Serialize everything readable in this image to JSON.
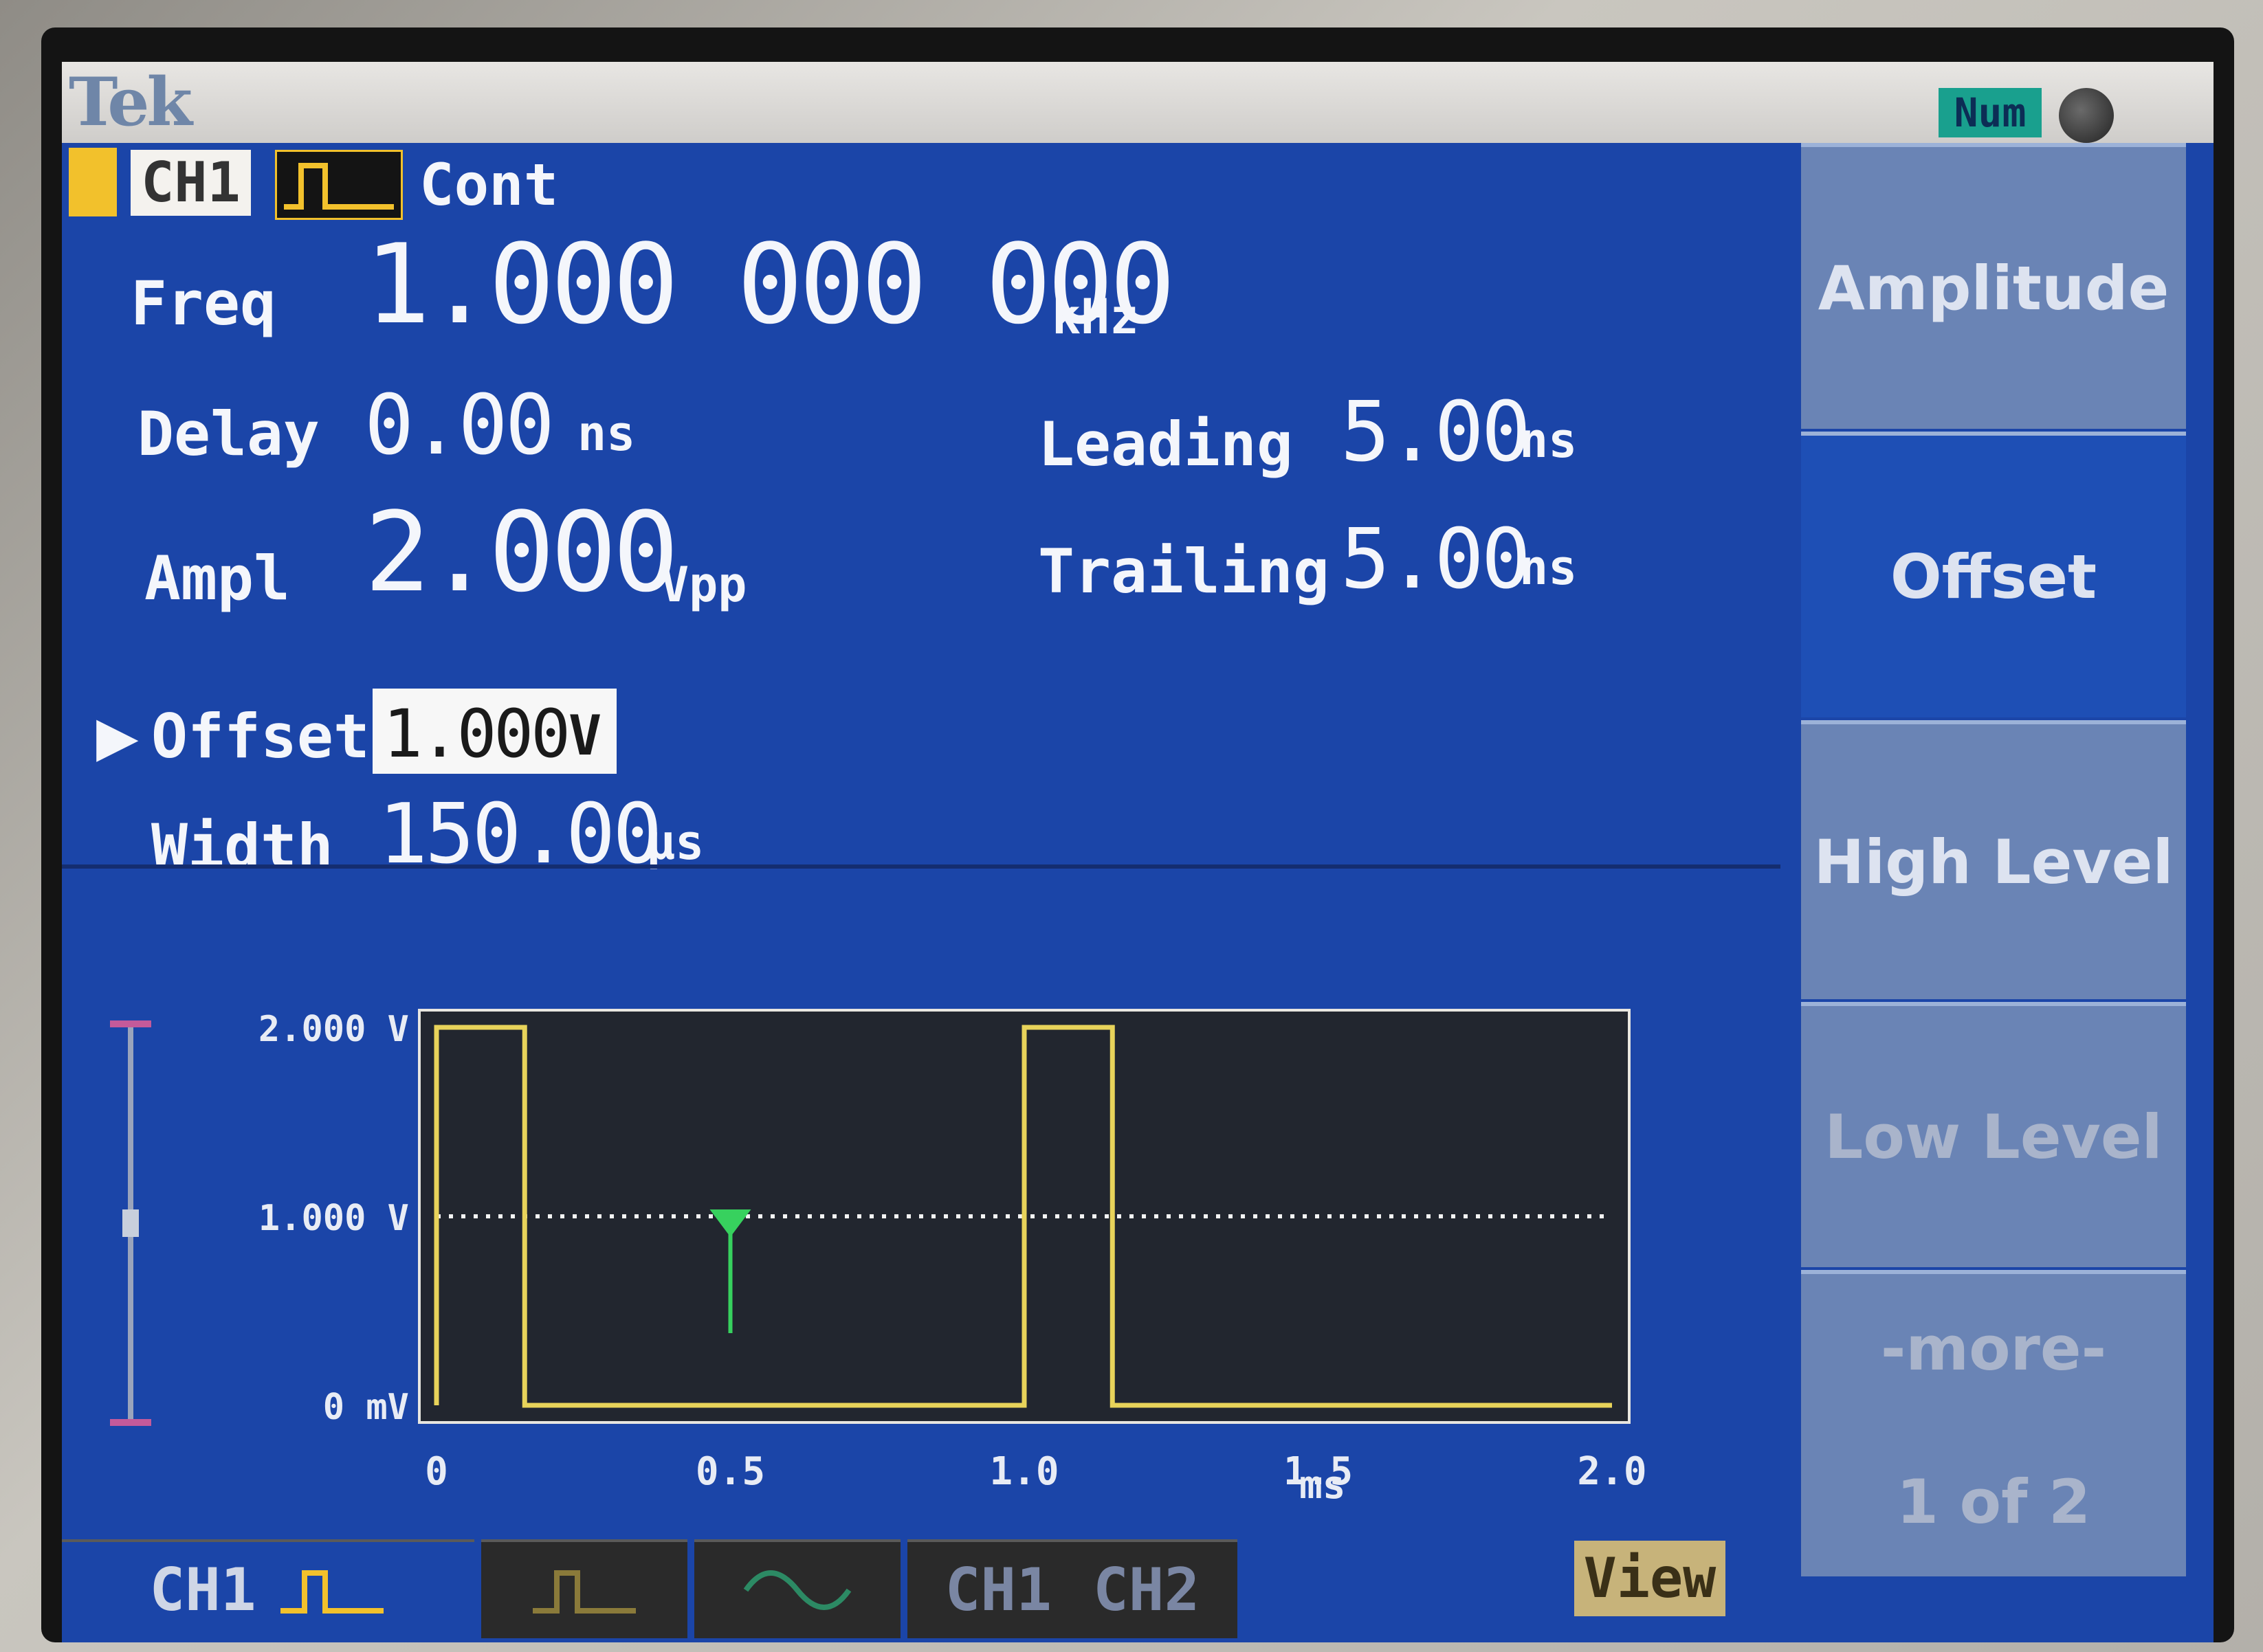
{
  "header": {
    "brand": "Tek",
    "num_badge": "Num"
  },
  "channel": {
    "label": "CH1",
    "mode": "Cont",
    "indicator_color": "#f2c12c"
  },
  "params": {
    "freq": {
      "label": "Freq",
      "value": "1.000 000 000",
      "unit": "kHz"
    },
    "delay": {
      "label": "Delay",
      "value": "0.00",
      "unit": "ns"
    },
    "ampl": {
      "label": "Ampl",
      "value": "2.000",
      "unit": "Vpp"
    },
    "offset": {
      "label": "Offset",
      "value": "1.000",
      "unit": "V"
    },
    "width": {
      "label": "Width",
      "value": "150.00",
      "unit": "µs"
    },
    "leading": {
      "label": "Leading",
      "value": "5.00",
      "unit": "ns"
    },
    "trailing": {
      "label": "Trailing",
      "value": "5.00",
      "unit": "ns"
    }
  },
  "softkeys": [
    {
      "label": "Amplitude",
      "active": false
    },
    {
      "label": "Offset",
      "active": true
    },
    {
      "label": "High Level",
      "active": false
    },
    {
      "label": "Low Level",
      "active": false
    },
    {
      "label": "-more-",
      "active": false
    },
    {
      "label": "1 of 2",
      "active": false
    }
  ],
  "tabs": [
    {
      "label": "CH1",
      "icon": "pulse-icon"
    },
    {
      "label": "",
      "icon": "pulse-icon"
    },
    {
      "label": "",
      "icon": "sine-icon"
    },
    {
      "label": "CH1",
      "icon": ""
    },
    {
      "label": "CH2",
      "icon": ""
    }
  ],
  "view_label": "View",
  "colors": {
    "screen_bg": "#1b45a8",
    "trace": "#e8d35a",
    "marker": "#37d15e",
    "plot_bg": "#22262f"
  },
  "chart_data": {
    "type": "line",
    "xlabel": "ms",
    "x_ticks": [
      "0",
      "0.5",
      "1.0",
      "1.5",
      "2.0"
    ],
    "y_ticks": [
      "0 mV",
      "1.000 V",
      "2.000 V"
    ],
    "xlim": [
      0,
      2.0
    ],
    "ylim": [
      0,
      2.0
    ],
    "series": [
      {
        "points": [
          [
            0,
            0
          ],
          [
            0,
            2
          ],
          [
            0.15,
            2
          ],
          [
            0.15,
            0
          ],
          [
            1.0,
            0
          ],
          [
            1.0,
            2
          ],
          [
            1.15,
            2
          ],
          [
            1.15,
            0
          ],
          [
            2.0,
            0
          ]
        ]
      }
    ],
    "reference_level": 1.0,
    "marker_x": 0.5
  }
}
